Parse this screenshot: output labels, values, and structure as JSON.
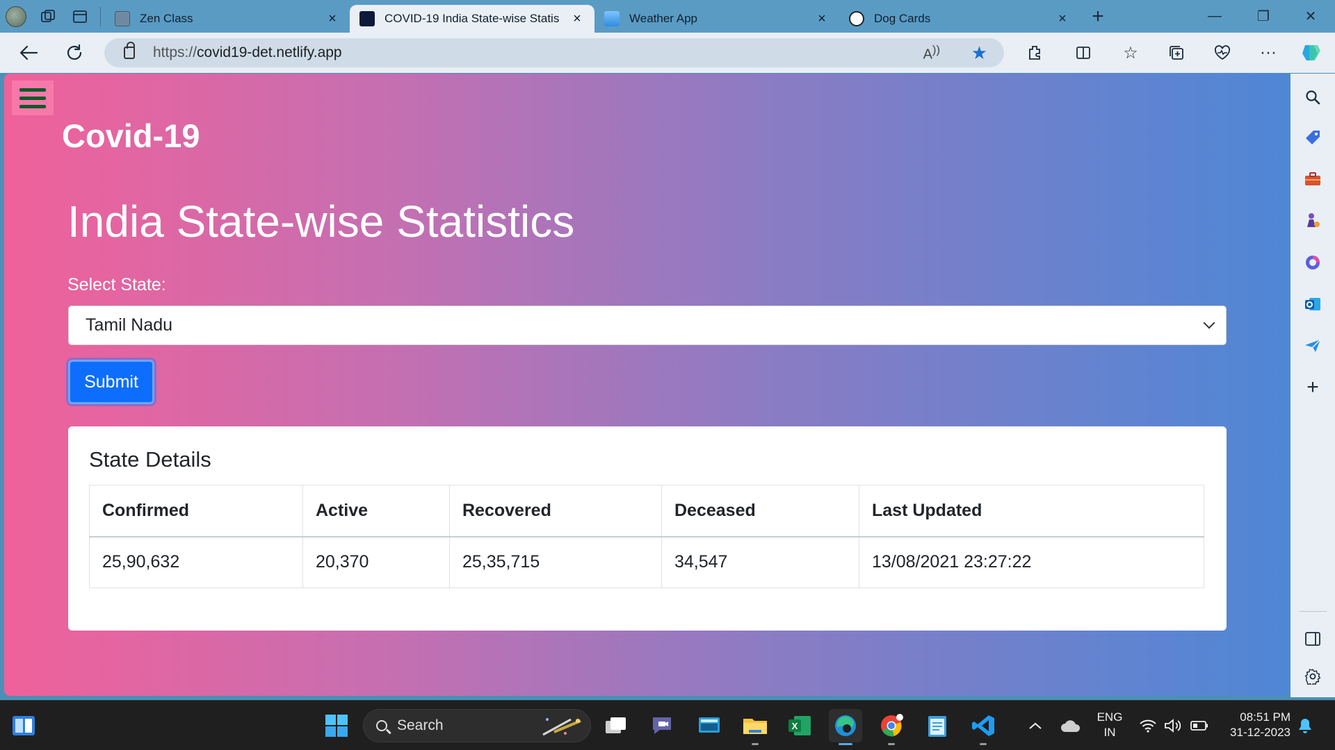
{
  "browser": {
    "tabs": [
      {
        "title": "Zen Class",
        "close": "×"
      },
      {
        "title": "COVID-19 India State-wise Statis",
        "close": "×"
      },
      {
        "title": "Weather App",
        "close": "×"
      },
      {
        "title": "Dog Cards",
        "close": "×"
      }
    ],
    "new_tab": "+",
    "window": {
      "minimize": "—",
      "restore": "❐",
      "close": "✕"
    },
    "url_prefix": "https://",
    "url_host": "covid19-det.netlify.app"
  },
  "page": {
    "brand": "Covid-19",
    "heading": "India State-wise Statistics",
    "select_label": "Select State:",
    "selected_state": "Tamil Nadu",
    "submit_label": "Submit",
    "card_title": "State Details",
    "table": {
      "headers": [
        "Confirmed",
        "Active",
        "Recovered",
        "Deceased",
        "Last Updated"
      ],
      "row": [
        "25,90,632",
        "20,370",
        "25,35,715",
        "34,547",
        "13/08/2021 23:27:22"
      ]
    }
  },
  "taskbar": {
    "search_label": "Search",
    "lang_line1": "ENG",
    "lang_line2": "IN",
    "time": "08:51 PM",
    "date": "31-12-2023"
  },
  "colors": {
    "gradient_start": "#f0619a",
    "gradient_end": "#4e87d6",
    "submit_bg": "#0d6efd",
    "hamburger": "#0d5a2a"
  }
}
